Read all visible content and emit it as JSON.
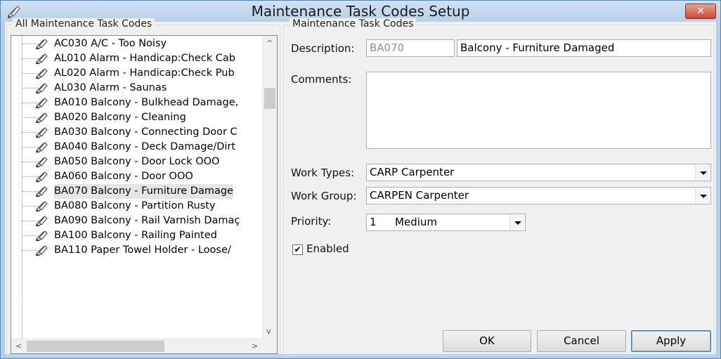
{
  "window": {
    "title": "Maintenance Task Codes Setup"
  },
  "left_group": {
    "legend": "All Maintenance Task Codes"
  },
  "tree": {
    "items": [
      {
        "label": "AC030  A/C - Too Noisy",
        "selected": false
      },
      {
        "label": "AL010  Alarm - Handicap:Check Cab",
        "selected": false
      },
      {
        "label": "AL020  Alarm - Handicap:Check Pub",
        "selected": false
      },
      {
        "label": "AL030  Alarm - Saunas",
        "selected": false
      },
      {
        "label": "BA010  Balcony - Bulkhead Damage,",
        "selected": false
      },
      {
        "label": "BA020  Balcony - Cleaning",
        "selected": false
      },
      {
        "label": "BA030  Balcony - Connecting Door C",
        "selected": false
      },
      {
        "label": "BA040  Balcony - Deck Damage/Dirt",
        "selected": false
      },
      {
        "label": "BA050  Balcony - Door Lock OOO",
        "selected": false
      },
      {
        "label": "BA060  Balcony - Door OOO",
        "selected": false
      },
      {
        "label": "BA070  Balcony - Furniture Damage",
        "selected": true
      },
      {
        "label": "BA080  Balcony - Partition Rusty",
        "selected": false
      },
      {
        "label": "BA090  Balcony - Rail Varnish Damaç",
        "selected": false
      },
      {
        "label": "BA100  Balcony - Railing Painted",
        "selected": false
      },
      {
        "label": "BA110  Paper Towel Holder - Loose/",
        "selected": false
      }
    ]
  },
  "right_group": {
    "legend": "Maintenance Task Codes"
  },
  "form": {
    "description_label": "Description:",
    "code_value": "BA070",
    "description_value": "Balcony - Furniture Damaged",
    "comments_label": "Comments:",
    "comments_value": "",
    "work_types_label": "Work Types:",
    "work_types_value": "CARP Carpenter",
    "work_group_label": "Work Group:",
    "work_group_value": "CARPEN Carpenter",
    "priority_label": "Priority:",
    "priority_number": "1",
    "priority_text": "Medium",
    "enabled_label": "Enabled",
    "enabled_checked": true
  },
  "buttons": {
    "ok": "OK",
    "cancel": "Cancel",
    "apply": "Apply"
  },
  "icons": {
    "app": "pencils-icon",
    "close": "close-icon",
    "tree_item": "task-pencils-icon"
  },
  "colors": {
    "title_bar": "#b9d1ea",
    "close_button": "#c74a36",
    "default_button_border": "#3c7fb1"
  }
}
